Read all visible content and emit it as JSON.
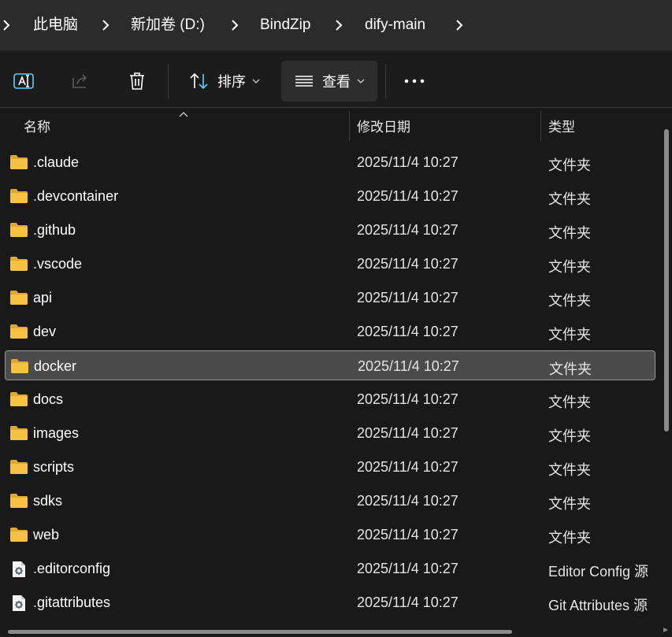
{
  "breadcrumb": {
    "items": [
      "此电脑",
      "新加卷 (D:)",
      "BindZip",
      "dify-main"
    ]
  },
  "toolbar": {
    "sort_label": "排序",
    "view_label": "查看",
    "icons": [
      "rename-icon",
      "share-icon",
      "delete-icon",
      "sort-icon",
      "view-icon",
      "more-icon"
    ]
  },
  "columns": {
    "name": "名称",
    "date": "修改日期",
    "type": "类型"
  },
  "files": [
    {
      "name": ".claude",
      "date": "2025/11/4 10:27",
      "type": "文件夹",
      "kind": "folder"
    },
    {
      "name": ".devcontainer",
      "date": "2025/11/4 10:27",
      "type": "文件夹",
      "kind": "folder"
    },
    {
      "name": ".github",
      "date": "2025/11/4 10:27",
      "type": "文件夹",
      "kind": "folder"
    },
    {
      "name": ".vscode",
      "date": "2025/11/4 10:27",
      "type": "文件夹",
      "kind": "folder"
    },
    {
      "name": "api",
      "date": "2025/11/4 10:27",
      "type": "文件夹",
      "kind": "folder"
    },
    {
      "name": "dev",
      "date": "2025/11/4 10:27",
      "type": "文件夹",
      "kind": "folder"
    },
    {
      "name": "docker",
      "date": "2025/11/4 10:27",
      "type": "文件夹",
      "kind": "folder",
      "selected": true
    },
    {
      "name": "docs",
      "date": "2025/11/4 10:27",
      "type": "文件夹",
      "kind": "folder"
    },
    {
      "name": "images",
      "date": "2025/11/4 10:27",
      "type": "文件夹",
      "kind": "folder"
    },
    {
      "name": "scripts",
      "date": "2025/11/4 10:27",
      "type": "文件夹",
      "kind": "folder"
    },
    {
      "name": "sdks",
      "date": "2025/11/4 10:27",
      "type": "文件夹",
      "kind": "folder"
    },
    {
      "name": "web",
      "date": "2025/11/4 10:27",
      "type": "文件夹",
      "kind": "folder"
    },
    {
      "name": ".editorconfig",
      "date": "2025/11/4 10:27",
      "type": "Editor Config 源",
      "kind": "config"
    },
    {
      "name": ".gitattributes",
      "date": "2025/11/4 10:27",
      "type": "Git Attributes 源",
      "kind": "config"
    }
  ],
  "colors": {
    "folder": "#f5c244",
    "selection_bg": "#4b4b4b",
    "accent": "#60cdff"
  }
}
